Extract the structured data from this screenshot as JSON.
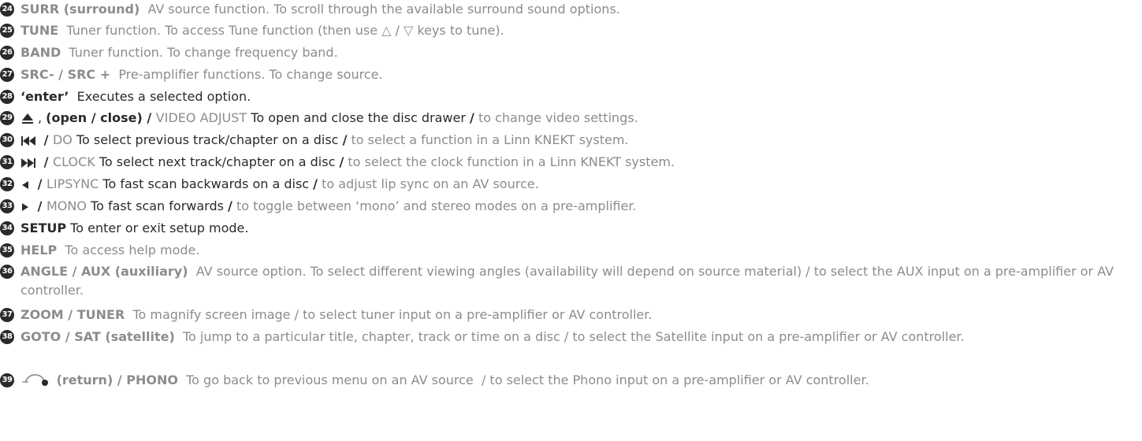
{
  "colors": {
    "grey": "#8c8c8c",
    "dark": "#2a2a2a",
    "background": "#ffffff"
  },
  "items": [
    {
      "number": "24",
      "segments": [
        {
          "t": "SURR (surround)",
          "s": "gb"
        },
        {
          "t": "  AV source function. To scroll through the available surround sound options.",
          "s": "g"
        }
      ]
    },
    {
      "number": "25",
      "segments": [
        {
          "t": "TUNE",
          "s": "gb"
        },
        {
          "t": "  Tuner function. To access Tune function (then use ",
          "s": "g"
        },
        {
          "t": "△",
          "s": "g"
        },
        {
          "t": " / ",
          "s": "g"
        },
        {
          "t": "▽",
          "s": "g"
        },
        {
          "t": " keys to tune).",
          "s": "g"
        }
      ]
    },
    {
      "number": "26",
      "segments": [
        {
          "t": "BAND",
          "s": "gb"
        },
        {
          "t": "  Tuner function. To change frequency band.",
          "s": "g"
        }
      ]
    },
    {
      "number": "27",
      "segments": [
        {
          "t": "SRC- / SRC +",
          "s": "gb"
        },
        {
          "t": "  Pre-amplifier functions. To change source.",
          "s": "g"
        }
      ]
    },
    {
      "number": "28",
      "segments": [
        {
          "t": "‘enter’",
          "s": "kb"
        },
        {
          "t": "  Executes a selected option.",
          "s": "k"
        }
      ]
    },
    {
      "number": "29",
      "icon": "eject-icon",
      "segments": [
        {
          "t": ", ",
          "s": "k"
        },
        {
          "t": "(open / close) / ",
          "s": "kb"
        },
        {
          "t": "VIDEO ADJUST",
          "s": "g"
        },
        {
          "t": " To open and close the disc drawer ",
          "s": "k"
        },
        {
          "t": "/",
          "s": "kb"
        },
        {
          "t": " to change video settings.",
          "s": "g"
        }
      ]
    },
    {
      "number": "30",
      "icon": "skip-back-icon",
      "segments": [
        {
          "t": " / ",
          "s": "kb"
        },
        {
          "t": "DO",
          "s": "g"
        },
        {
          "t": " To select previous track/chapter on a disc ",
          "s": "k"
        },
        {
          "t": "/",
          "s": "kb"
        },
        {
          "t": " to select a function in a Linn KNEKT system.",
          "s": "g"
        }
      ]
    },
    {
      "number": "31",
      "icon": "skip-forward-icon",
      "segments": [
        {
          "t": " / ",
          "s": "kb"
        },
        {
          "t": "CLOCK",
          "s": "g"
        },
        {
          "t": " To select next track/chapter on a disc ",
          "s": "k"
        },
        {
          "t": "/",
          "s": "kb"
        },
        {
          "t": " to select the clock function in a Linn KNEKT system.",
          "s": "g"
        }
      ]
    },
    {
      "number": "32",
      "icon": "scan-back-icon",
      "segments": [
        {
          "t": " / ",
          "s": "kb"
        },
        {
          "t": "LIPSYNC",
          "s": "g"
        },
        {
          "t": " To fast scan backwards on a disc ",
          "s": "k"
        },
        {
          "t": "/",
          "s": "kb"
        },
        {
          "t": " to adjust lip sync on an AV source.",
          "s": "g"
        }
      ]
    },
    {
      "number": "33",
      "icon": "scan-forward-icon",
      "segments": [
        {
          "t": " / ",
          "s": "kb"
        },
        {
          "t": "MONO",
          "s": "g"
        },
        {
          "t": " To fast scan forwards ",
          "s": "k"
        },
        {
          "t": "/",
          "s": "kb"
        },
        {
          "t": " to toggle between ‘mono’ and stereo modes on a pre-amplifier.",
          "s": "g"
        }
      ]
    },
    {
      "number": "34",
      "segments": [
        {
          "t": "SETUP",
          "s": "kb"
        },
        {
          "t": " To enter or exit setup mode.",
          "s": "k"
        }
      ]
    },
    {
      "number": "35",
      "segments": [
        {
          "t": "HELP",
          "s": "gb"
        },
        {
          "t": "  To access help mode.",
          "s": "g"
        }
      ]
    },
    {
      "number": "36",
      "segments": [
        {
          "t": "ANGLE / AUX (auxiliary)",
          "s": "gb"
        },
        {
          "t": "  AV source option. To select different viewing angles (availability will depend on source material) / to select the AUX input on a pre-amplifier or AV controller.",
          "s": "g"
        }
      ]
    },
    {
      "number": "37",
      "segments": [
        {
          "t": "ZOOM / TUNER",
          "s": "gb"
        },
        {
          "t": "  To magnify screen image / to select tuner input on a pre-amplifier or AV controller.",
          "s": "g"
        }
      ]
    },
    {
      "number": "38",
      "segments": [
        {
          "t": "GOTO / SAT (satellite)",
          "s": "gb"
        },
        {
          "t": "  To jump to a particular title, chapter, track or time on a disc / to select the Satellite input on a pre-amplifier or AV controller.",
          "s": "g"
        }
      ]
    },
    {
      "number": "39",
      "icon": "return-icon",
      "segments": [
        {
          "t": " (return) / PHONO",
          "s": "gb"
        },
        {
          "t": "  To go back to previous menu on an AV source  / to select the Phono input on a pre-amplifier or AV controller.",
          "s": "g"
        }
      ]
    }
  ]
}
